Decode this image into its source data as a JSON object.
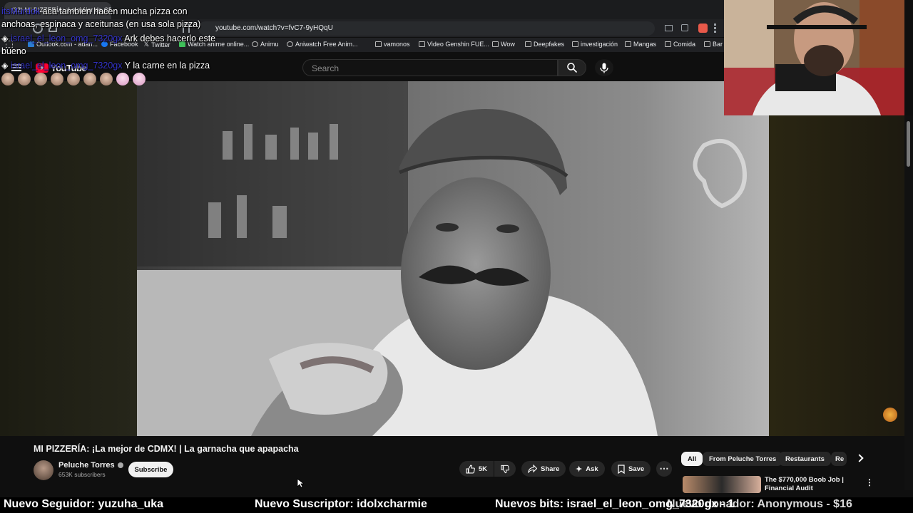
{
  "browser": {
    "tabs": [
      {
        "label": "(32) MI PIZZERÍA: ¡La mejor de CDMX!"
      }
    ],
    "url": "youtube.com/watch?v=fvC7-9yHQqU",
    "bookmarks": [
      {
        "label": "Outlook.com - adan...",
        "icon": "outlook-icon"
      },
      {
        "label": "Facebook",
        "icon": "facebook-icon"
      },
      {
        "label": "Twitter",
        "icon": "x-icon"
      },
      {
        "label": "Watch anime online...",
        "icon": "anime-icon"
      },
      {
        "label": "Animu",
        "icon": "globe-icon"
      },
      {
        "label": "Aniwatch Free Anim...",
        "icon": "aniwatch-icon"
      },
      {
        "label": "vamonos",
        "icon": "folder-icon"
      },
      {
        "label": "Video Genshin FUE...",
        "icon": "folder-icon"
      },
      {
        "label": "Wow",
        "icon": "folder-icon"
      },
      {
        "label": "Deepfakes",
        "icon": "folder-icon"
      },
      {
        "label": "investigación",
        "icon": "folder-icon"
      },
      {
        "label": "Mangas",
        "icon": "folder-icon"
      },
      {
        "label": "Comida",
        "icon": "folder-icon"
      },
      {
        "label": "Bar",
        "icon": "folder-icon"
      }
    ]
  },
  "youtube": {
    "logo_text": "YouTube",
    "search_placeholder": "Search",
    "video_title": "MI PIZZERÍA: ¡La mejor de CDMX! | La garnacha que apapacha",
    "channel_name": "Peluche Torres",
    "subscribers": "653K subscribers",
    "subscribe_label": "Subscribe",
    "likes": "5K",
    "share_label": "Share",
    "ask_label": "Ask",
    "save_label": "Save",
    "chips": [
      "All",
      "From Peluche Torres",
      "Restaurants",
      "Re"
    ],
    "recommendation_title": "The $770,000 Boob Job | Financial Audit"
  },
  "chat": {
    "messages": [
      {
        "user": "itsMurdok",
        "text": "acá también hacen mucha pizza con anchoas, espinaca y aceitunas (en usa sola pizza)"
      },
      {
        "user": "israel_el_leon_omg_7320gx",
        "text": "Ark debes hacerlo este bueno"
      },
      {
        "user": "israel_el_leon_omg_7320gx",
        "text": "Y la carne en la pizza"
      }
    ]
  },
  "ticker": {
    "follower": "Nuevo Seguidor: yuzuha_uka",
    "subscriber": "Nuevo Suscriptor: idolxcharmie",
    "bits": "Nuevos bits: israel_el_leon_omg_7320gx - 1",
    "donor": "Nuevo donador: Anonymous - $16"
  },
  "colors": {
    "youtube_red": "#ff0033",
    "background": "#0f0f0f",
    "chat_username": "#3a3ae8"
  }
}
